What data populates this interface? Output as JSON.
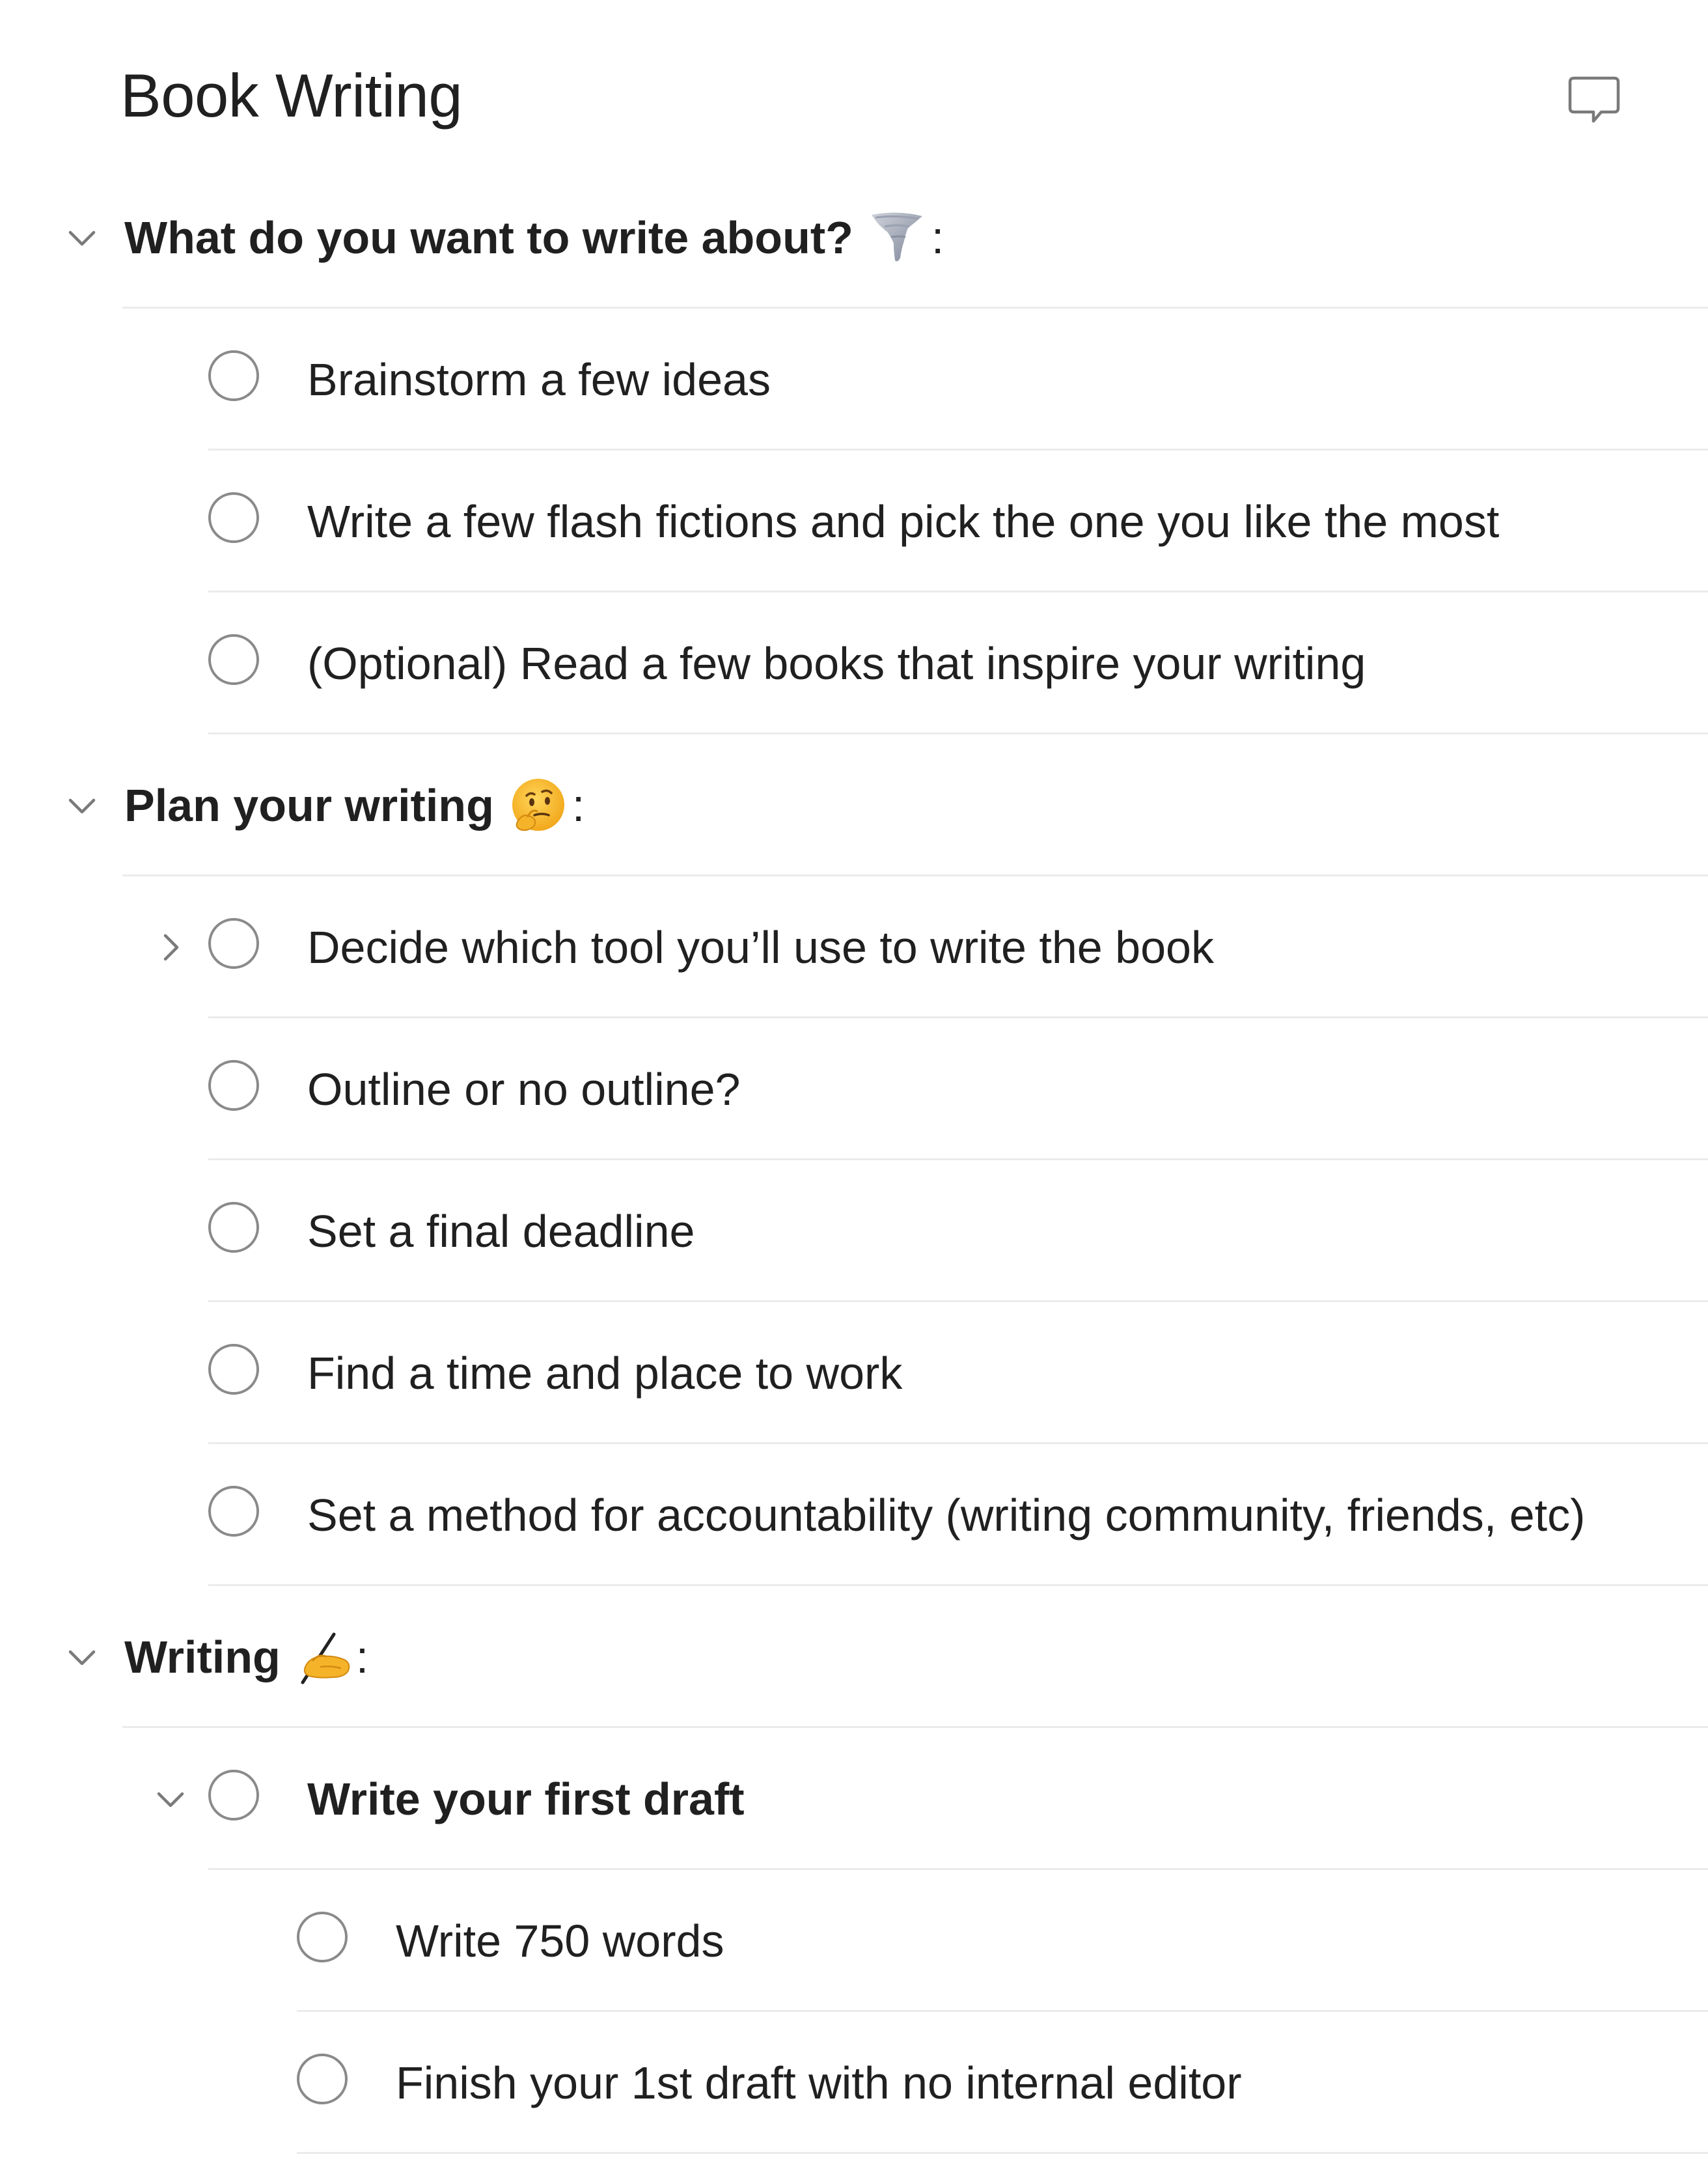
{
  "header": {
    "title": "Book Writing",
    "comment_icon": "comment-icon"
  },
  "sections": [
    {
      "label": "What do you want to write about?",
      "emoji": "tornado",
      "suffix": ":",
      "expanded": true,
      "tasks": [
        {
          "label": "Brainstorm a few ideas"
        },
        {
          "label": "Write a few flash fictions and pick the one you like the most"
        },
        {
          "label": "(Optional) Read a few books that inspire your writing"
        }
      ]
    },
    {
      "label": "Plan your writing",
      "emoji": "thinking-face",
      "suffix": ":",
      "expanded": true,
      "tasks": [
        {
          "label": "Decide which tool you’ll use to write the book",
          "has_subtasks": true,
          "expanded": false
        },
        {
          "label": "Outline or no outline?"
        },
        {
          "label": "Set a final deadline"
        },
        {
          "label": "Find a time and place to work"
        },
        {
          "label": "Set a method for accountability (writing community, friends, etc)"
        }
      ]
    },
    {
      "label": "Writing",
      "emoji": "writing-hand",
      "suffix": ":",
      "expanded": true,
      "tasks": [
        {
          "label": "Write your first draft",
          "has_subtasks": true,
          "expanded": true,
          "subtasks": [
            {
              "label": "Write 750 words"
            },
            {
              "label": "Finish your 1st draft with no internal editor"
            }
          ]
        }
      ]
    }
  ],
  "colors": {
    "text": "#202020",
    "separator": "#ebebeb",
    "checkbox_border": "#8a8a8a",
    "chevron": "#7a7a7a"
  }
}
